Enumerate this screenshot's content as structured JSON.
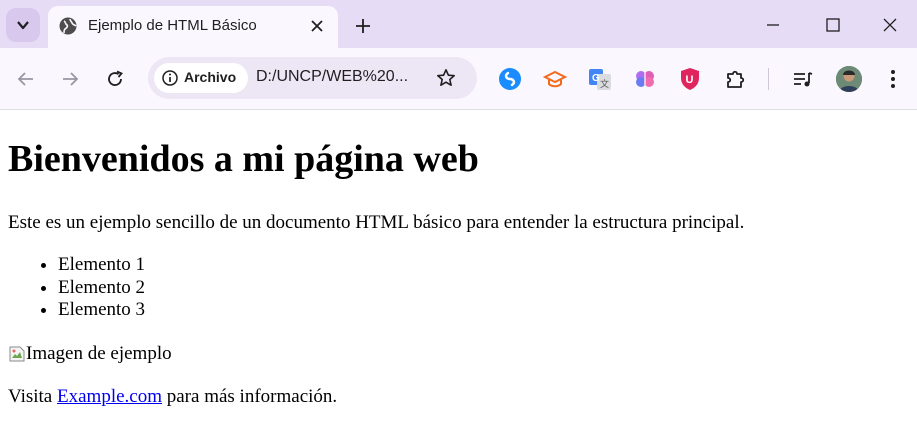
{
  "tabs": [
    {
      "title": "Ejemplo de HTML Básico",
      "favicon": "globe-icon"
    }
  ],
  "toolbar": {
    "security_chip": "Archivo",
    "url": "D:/UNCP/WEB%20...",
    "extensions": [
      "shazam-icon",
      "tutor-icon",
      "translate-icon",
      "brain-icon",
      "shield-u-icon",
      "puzzle-icon"
    ]
  },
  "colors": {
    "tabstrip": "#e7dcf5",
    "toolbar": "#fbf7ff",
    "link": "#0000ee"
  },
  "page": {
    "heading": "Bienvenidos a mi página web",
    "intro": "Este es un ejemplo sencillo de un documento HTML básico para entender la estructura principal.",
    "list_items": [
      "Elemento 1",
      "Elemento 2",
      "Elemento 3"
    ],
    "image_alt": "Imagen de ejemplo",
    "visit_prefix": "Visita ",
    "link_text": "Example.com",
    "visit_suffix": " para más información."
  }
}
